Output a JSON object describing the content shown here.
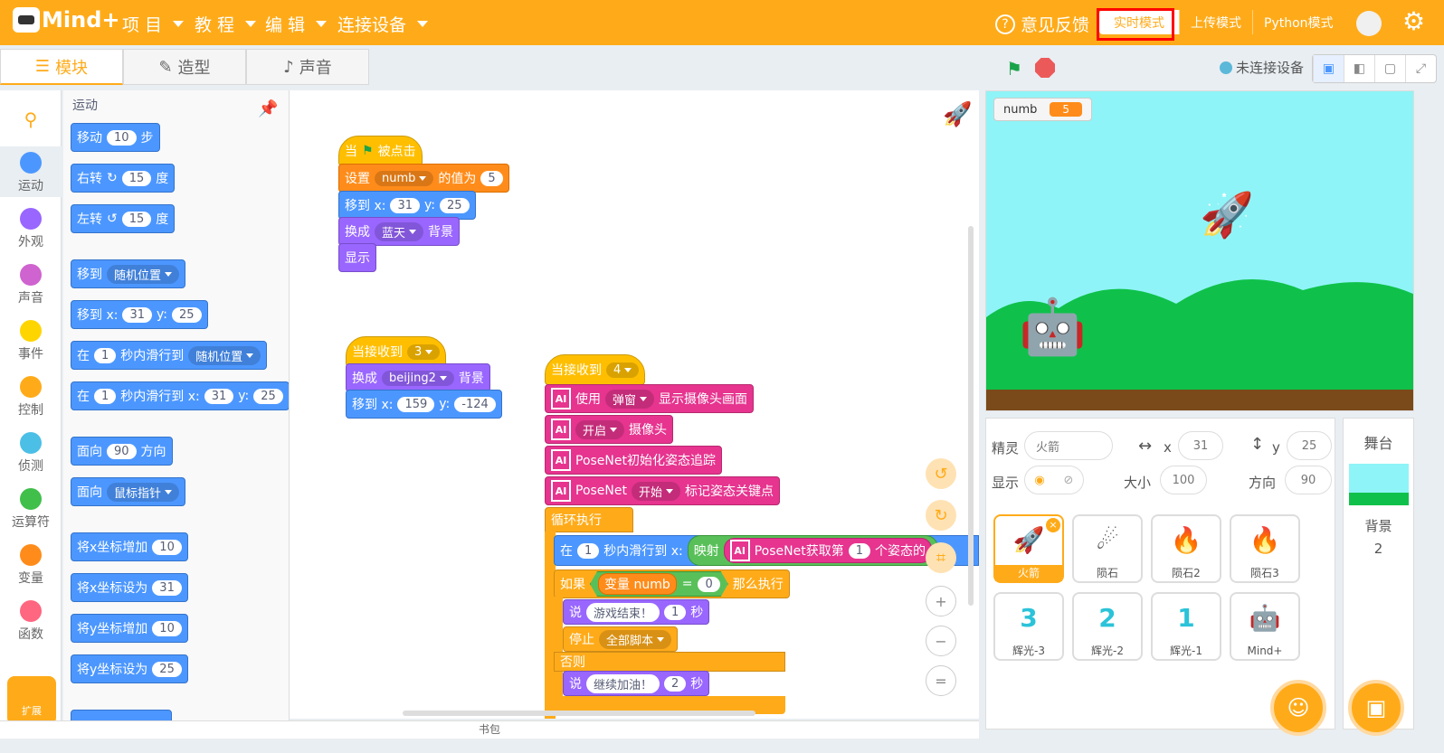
{
  "topbar": {
    "logo": "Mind+",
    "menus": [
      "项 目",
      "教 程",
      "编 辑",
      "连接设备"
    ],
    "feedback": "意见反馈",
    "modes": [
      "实时模式",
      "上传模式",
      "Python模式"
    ]
  },
  "tabs": [
    "模块",
    "造型",
    "声音"
  ],
  "stage_bar": {
    "connection": "未连接设备"
  },
  "categories": [
    {
      "label": "运动",
      "color": "#4c97ff"
    },
    {
      "label": "外观",
      "color": "#9966ff"
    },
    {
      "label": "声音",
      "color": "#cf63cf"
    },
    {
      "label": "事件",
      "color": "#ffd500"
    },
    {
      "label": "控制",
      "color": "#ffab19"
    },
    {
      "label": "侦测",
      "color": "#4cbfe6"
    },
    {
      "label": "运算符",
      "color": "#40bf4a"
    },
    {
      "label": "变量",
      "color": "#ff8c1a"
    },
    {
      "label": "函数",
      "color": "#ff6680"
    }
  ],
  "extension_label": "扩展",
  "palette": {
    "title": "运动",
    "b1": {
      "a": "移动",
      "n": "10",
      "b": "步"
    },
    "b2": {
      "a": "右转",
      "n": "15",
      "b": "度"
    },
    "b3": {
      "a": "左转",
      "n": "15",
      "b": "度"
    },
    "b4": {
      "a": "移到",
      "d": "随机位置"
    },
    "b5": {
      "a": "移到 x:",
      "x": "31",
      "y_label": "y:",
      "y": "25"
    },
    "b6": {
      "a": "在",
      "n": "1",
      "b": "秒内滑行到",
      "d": "随机位置"
    },
    "b7": {
      "a": "在",
      "n": "1",
      "b": "秒内滑行到 x:",
      "x": "31",
      "y_label": "y:",
      "y": "25"
    },
    "b8": {
      "a": "面向",
      "n": "90",
      "b": "方向"
    },
    "b9": {
      "a": "面向",
      "d": "鼠标指针"
    },
    "b10": {
      "a": "将x坐标增加",
      "n": "10"
    },
    "b11": {
      "a": "将x坐标设为",
      "n": "31"
    },
    "b12": {
      "a": "将y坐标增加",
      "n": "10"
    },
    "b13": {
      "a": "将y坐标设为",
      "n": "25"
    }
  },
  "script1": {
    "hat": {
      "a": "当",
      "b": "被点击"
    },
    "set": {
      "a": "设置",
      "d": "numb",
      "b": "的值为",
      "n": "5"
    },
    "goto": {
      "a": "移到 x:",
      "x": "31",
      "y_label": "y:",
      "y": "25"
    },
    "backdrop": {
      "a": "换成",
      "d": "蓝天",
      "b": "背景"
    },
    "show": "显示"
  },
  "script2": {
    "hat": {
      "a": "当接收到",
      "d": "3"
    },
    "backdrop": {
      "a": "换成",
      "d": "beijing2",
      "b": "背景"
    },
    "goto": {
      "a": "移到 x:",
      "x": "159",
      "y_label": "y:",
      "y": "-124"
    }
  },
  "script3": {
    "hat": {
      "a": "当接收到",
      "d": "4"
    },
    "ai1": {
      "a": "使用",
      "d": "弹窗",
      "b": "显示摄像头画面"
    },
    "ai2": {
      "d": "开启",
      "b": "摄像头"
    },
    "ai3": "PoseNet初始化姿态追踪",
    "ai4": {
      "a": "PoseNet",
      "d": "开始",
      "b": "标记姿态关键点"
    },
    "loop": "循环执行",
    "glide": {
      "a": "在",
      "n": "1",
      "b": "秒内滑行到 x:",
      "c": "映射",
      "e": "PoseNet获取第",
      "m": "1",
      "f": "个姿态的"
    },
    "if": {
      "a": "如果",
      "v": "变量 numb",
      "eq": "=",
      "n": "0",
      "b": "那么执行"
    },
    "say1": {
      "a": "说",
      "t": "游戏结束！",
      "n": "1",
      "b": "秒"
    },
    "stop": {
      "a": "停止",
      "d": "全部脚本"
    },
    "else": "否则",
    "say2": {
      "a": "说",
      "t": "继续加油！",
      "n": "2",
      "b": "秒"
    }
  },
  "backpack": "书包",
  "monitor": {
    "name": "numb",
    "value": "5"
  },
  "sprite_info": {
    "sprite_label": "精灵",
    "sprite_name": "火箭",
    "x_label": "x",
    "x": "31",
    "y_label": "y",
    "y": "25",
    "show_label": "显示",
    "size_label": "大小",
    "size": "100",
    "dir_label": "方向",
    "dir": "90"
  },
  "sprites": [
    "火箭",
    "陨石",
    "陨石2",
    "陨石3",
    "辉光-3",
    "辉光-2",
    "辉光-1",
    "Mind+"
  ],
  "stage_side": {
    "title": "舞台",
    "label": "背景",
    "count": "2"
  }
}
